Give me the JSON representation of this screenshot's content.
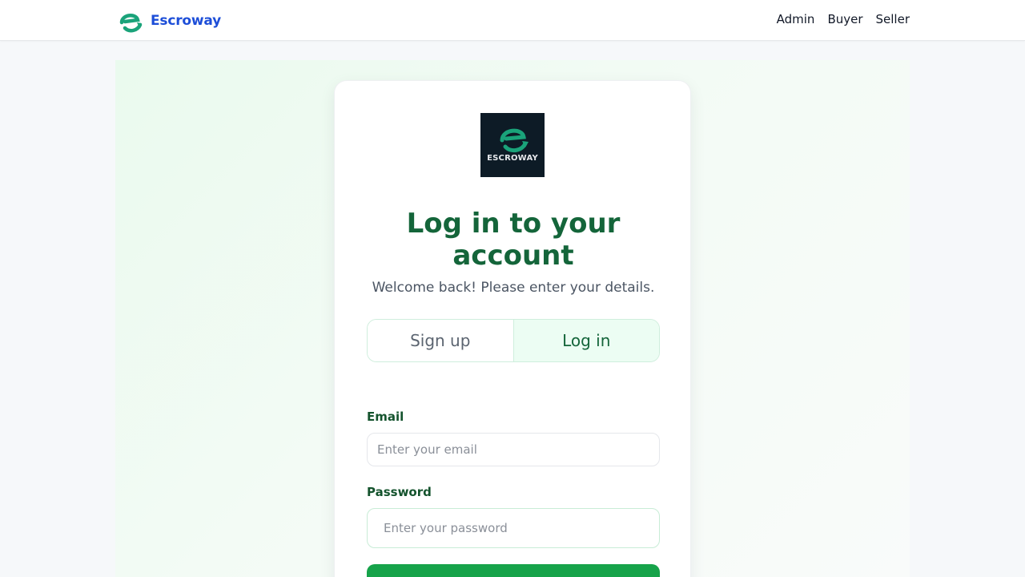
{
  "navbar": {
    "brand_name": "Escroway",
    "links": [
      {
        "label": "Admin"
      },
      {
        "label": "Buyer"
      },
      {
        "label": "Seller"
      }
    ]
  },
  "card": {
    "logo_text": "ESCROWAY",
    "title": "Log in to your account",
    "subtitle": "Welcome back! Please enter your details.",
    "tabs": [
      {
        "label": "Sign up",
        "active": false
      },
      {
        "label": "Log in",
        "active": true
      }
    ],
    "form": {
      "email_label": "Email",
      "email_placeholder": "Enter your email",
      "email_value": "",
      "password_label": "Password",
      "password_placeholder": "Enter your password",
      "password_value": ""
    }
  },
  "colors": {
    "brand_blue": "#1d4ed8",
    "primary_green": "#16a34a",
    "dark_green": "#14653a",
    "logo_bg": "#0d1b26"
  },
  "icons": {
    "brand": "escroway-e-logo-icon"
  }
}
